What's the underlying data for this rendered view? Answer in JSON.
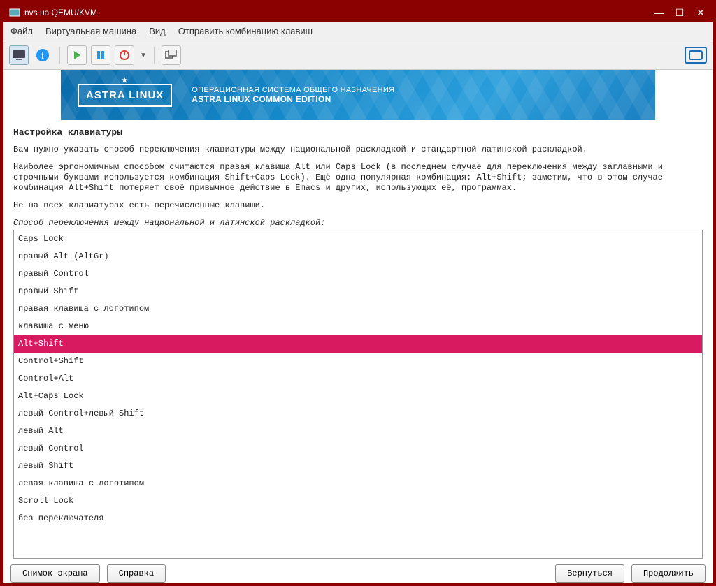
{
  "window": {
    "title": "nvs на QEMU/KVM"
  },
  "menu": {
    "file": "Файл",
    "vm": "Виртуальная машина",
    "view": "Вид",
    "send_keys": "Отправить комбинацию клавиш"
  },
  "banner": {
    "logo": "ASTRA LINUX",
    "line1": "ОПЕРАЦИОННАЯ СИСТЕМА ОБЩЕГО НАЗНАЧЕНИЯ",
    "line2": "ASTRA LINUX COMMON EDITION"
  },
  "installer": {
    "title": "Настройка клавиатуры",
    "para1": "Вам нужно указать способ переключения клавиатуры между национальной раскладкой и стандартной латинской раскладкой.",
    "para2": "Наиболее эргономичным способом считаются правая клавиша Alt или Caps Lock (в последнем случае для переключения между заглавными и строчными буквами используется комбинация Shift+Caps Lock). Ещё одна популярная комбинация: Alt+Shift; заметим, что в этом случае комбинация Alt+Shift потеряет своё привычное действие в Emacs и других, использующих её, программах.",
    "para3": "Не на всех клавиатурах есть перечисленные клавиши.",
    "subheading": "Способ переключения между национальной и латинской раскладкой:",
    "options": [
      "Caps Lock",
      "правый Alt (AltGr)",
      "правый Control",
      "правый Shift",
      "правая клавиша с логотипом",
      "клавиша с меню",
      "Alt+Shift",
      "Control+Shift",
      "Control+Alt",
      "Alt+Caps Lock",
      "левый Control+левый Shift",
      "левый Alt",
      "левый Control",
      "левый Shift",
      "левая клавиша с логотипом",
      "Scroll Lock",
      "без переключателя"
    ],
    "selected_index": 6
  },
  "buttons": {
    "screenshot": "Снимок экрана",
    "help": "Справка",
    "back": "Вернуться",
    "continue": "Продолжить"
  }
}
